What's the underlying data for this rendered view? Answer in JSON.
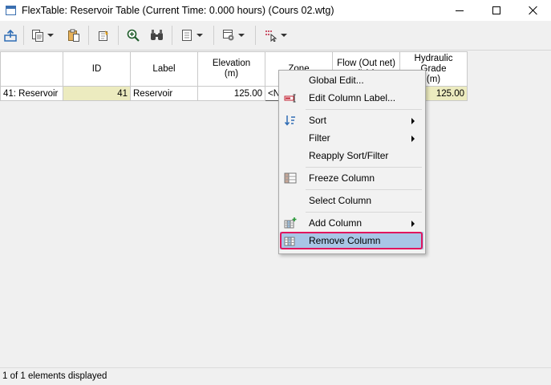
{
  "window": {
    "title": "FlexTable: Reservoir Table (Current Time:  0.000 hours) (Cours 02.wtg)"
  },
  "toolbar": {
    "buttons": [
      {
        "icon": "export-icon"
      },
      {
        "icon": "copy-icon"
      },
      {
        "icon": "paste-icon"
      },
      {
        "icon": "edit-icon"
      },
      {
        "icon": "zoom-icon"
      },
      {
        "icon": "find-icon"
      },
      {
        "icon": "report-icon"
      },
      {
        "icon": "options-icon"
      },
      {
        "icon": "filter-icon"
      }
    ]
  },
  "table": {
    "columns": [
      {
        "label": ""
      },
      {
        "label": "ID"
      },
      {
        "label": "Label"
      },
      {
        "label": "Elevation\n(m)"
      },
      {
        "label": "Zone"
      },
      {
        "label": "Flow (Out net)\n(L/s)"
      },
      {
        "label": "Hydraulic\nGrade\n(m)"
      }
    ],
    "rows": [
      {
        "row_header": "41: Reservoir",
        "id": "41",
        "label": "Reservoir",
        "elevation": "125.00",
        "zone": "<N",
        "flow": "",
        "hydraulic_grade": "125.00"
      }
    ]
  },
  "context_menu": {
    "items": [
      {
        "label": "Global Edit...",
        "icon": ""
      },
      {
        "label": "Edit Column Label...",
        "icon": "edit-label-icon"
      },
      {
        "label": "Sort",
        "icon": "sort-icon",
        "submenu": true
      },
      {
        "label": "Filter",
        "icon": "",
        "submenu": true
      },
      {
        "label": "Reapply Sort/Filter",
        "icon": ""
      },
      {
        "label": "Freeze Column",
        "icon": "freeze-column-icon"
      },
      {
        "label": "Select Column",
        "icon": ""
      },
      {
        "label": "Add Column",
        "icon": "add-column-icon",
        "submenu": true
      },
      {
        "label": "Remove Column",
        "icon": "remove-column-icon",
        "highlighted": true
      }
    ]
  },
  "status": {
    "text": "1 of 1 elements displayed"
  },
  "colors": {
    "readonly_cell": "#ecebbf",
    "menu_highlight": "#a8c6e6",
    "callout_border": "#e0165e"
  }
}
